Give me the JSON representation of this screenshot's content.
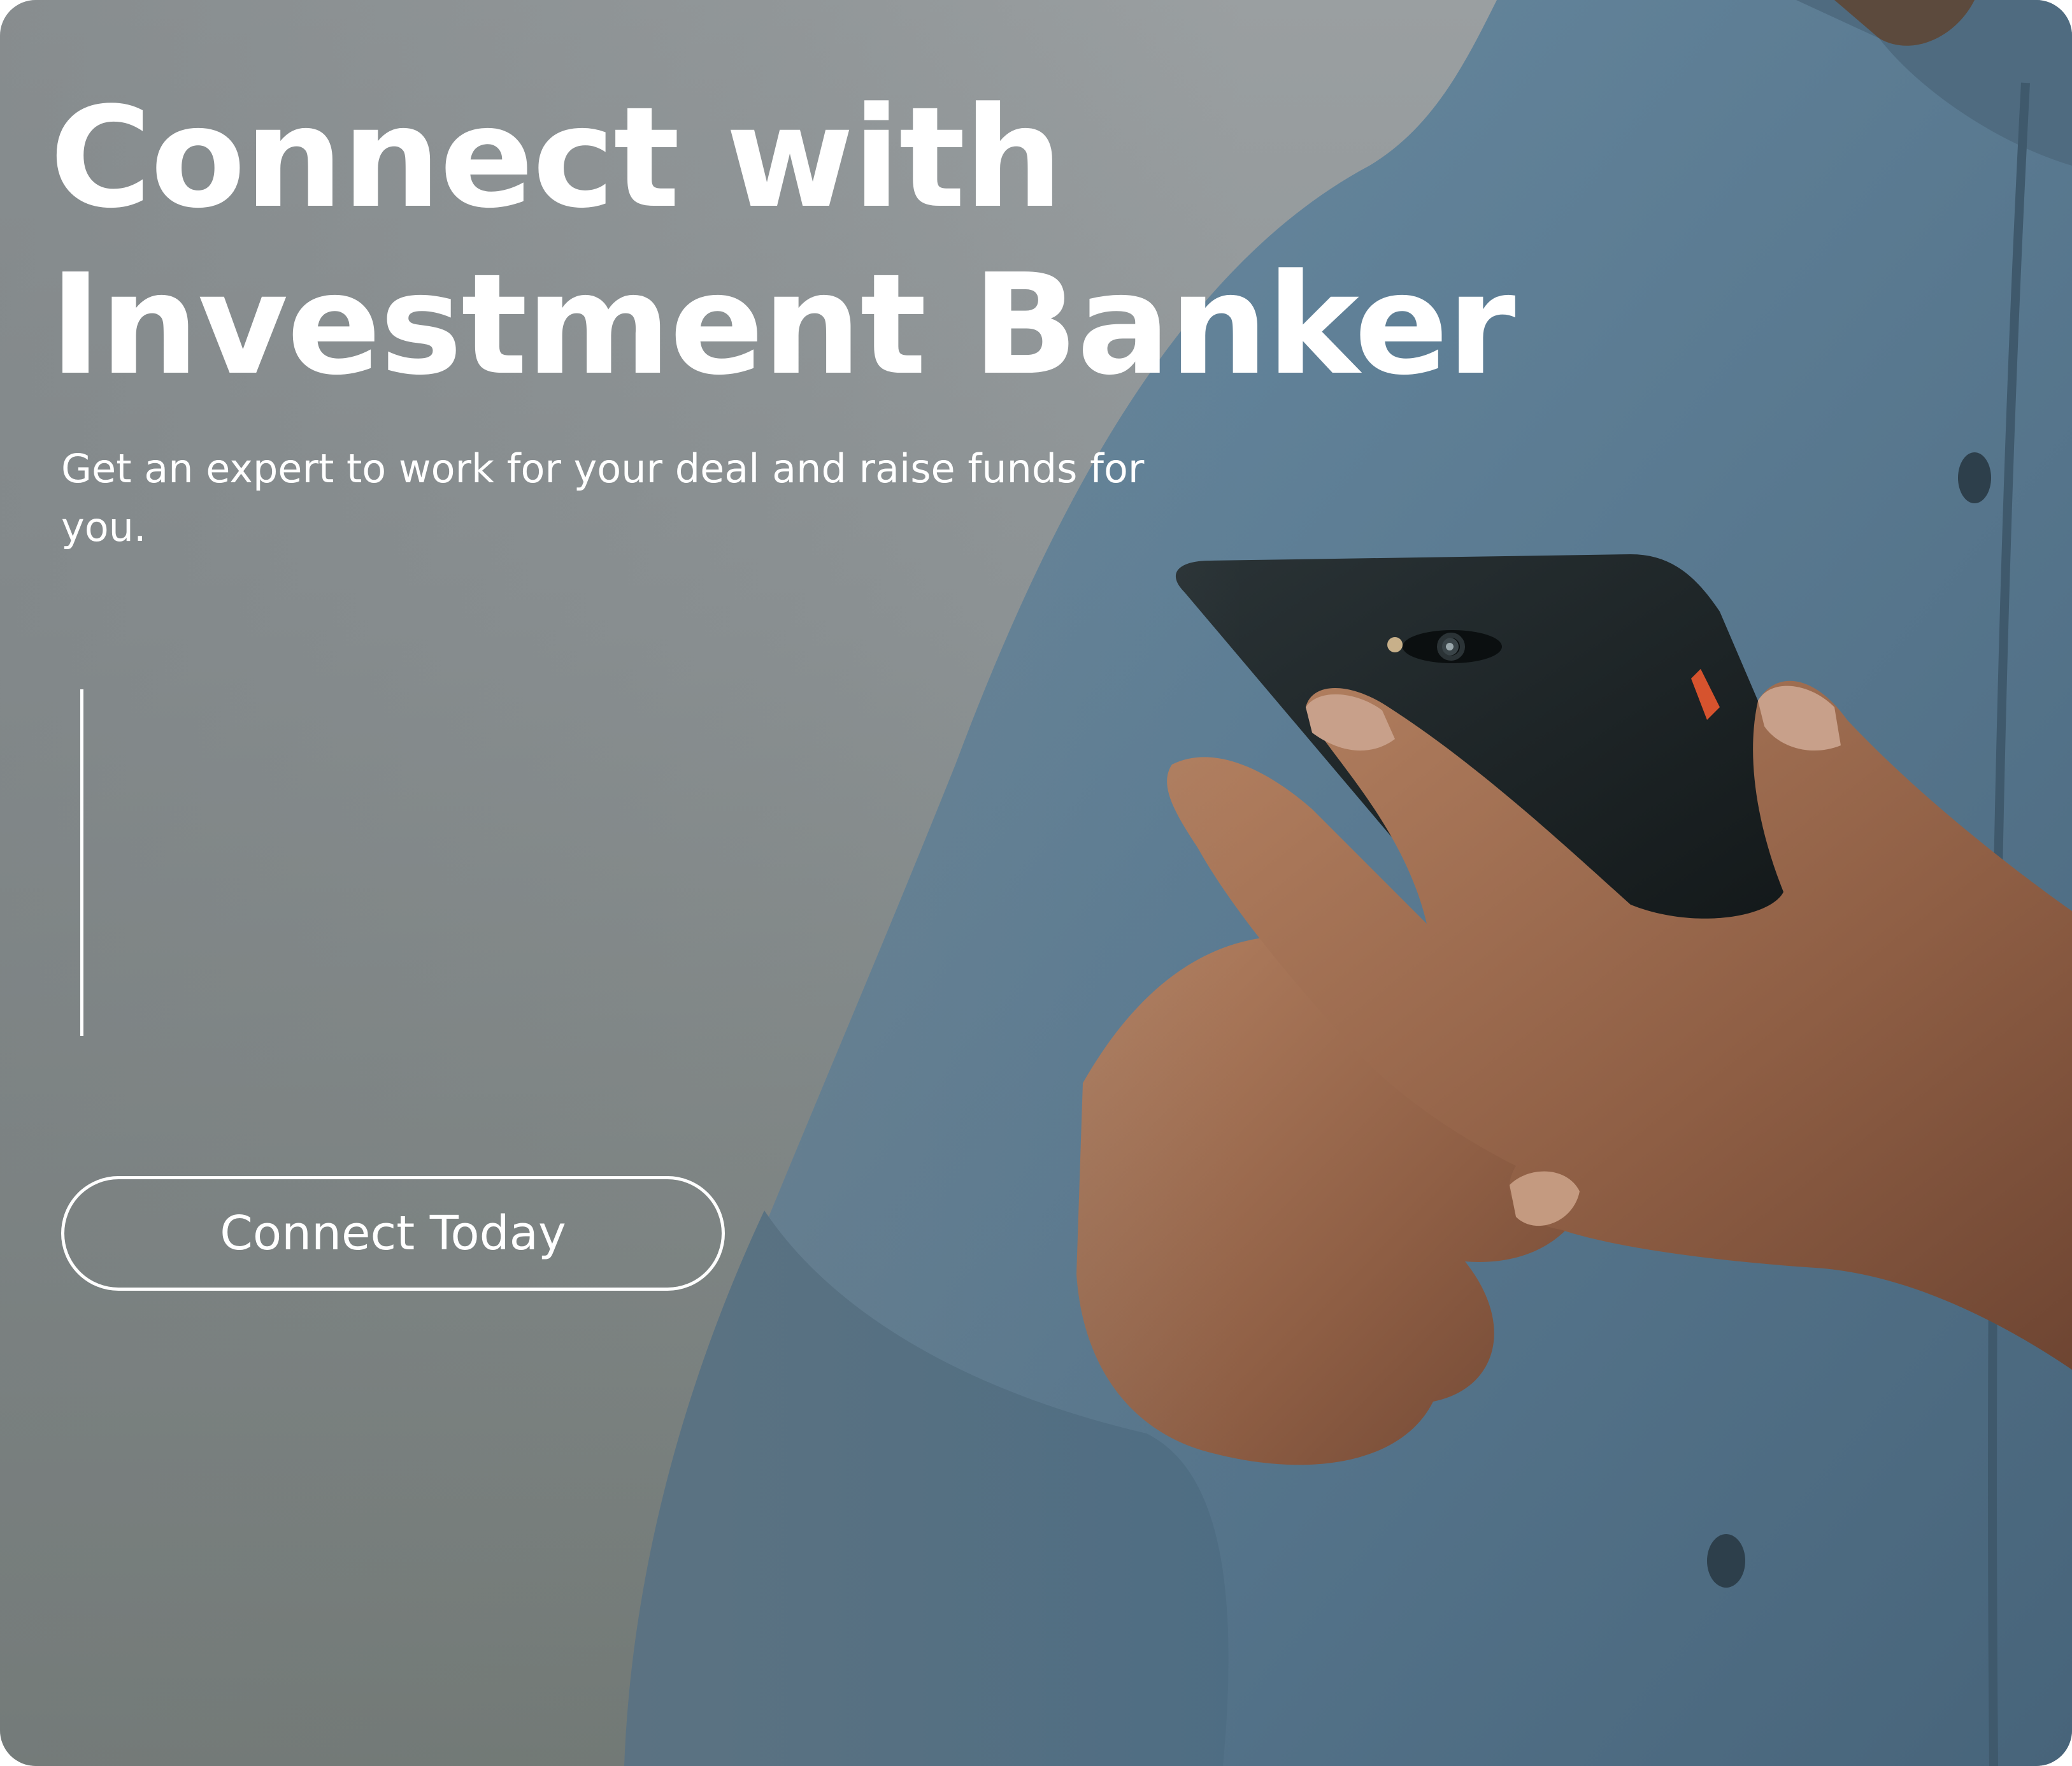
{
  "hero": {
    "headline_line1": "Connect with",
    "headline_line2": "Investment Banker",
    "subtitle": "Get an expert to work for your deal and raise funds for you.",
    "cta_label": "Connect Today"
  },
  "colors": {
    "text": "#ffffff",
    "background_gray": "#8f9597",
    "shirt_blue": "#5f7f95",
    "phone_black": "#1c2224",
    "skin": "#9a6a4e"
  },
  "image": {
    "subject": "person-holding-smartphone-photo"
  }
}
